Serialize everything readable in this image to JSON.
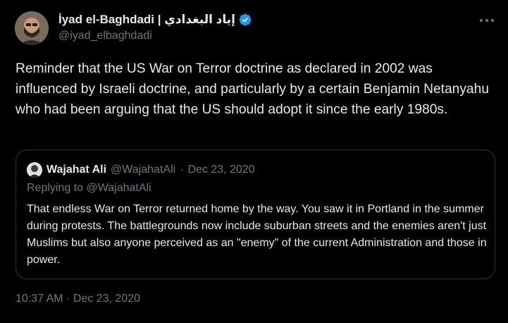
{
  "author": {
    "display_name": "İyad el-Baghdadi | إياد البغدادي",
    "handle": "@iyad_elbaghdadi",
    "verified_icon": "verified-badge-icon",
    "verified_color": "#1d9bf0"
  },
  "tweet": {
    "text": "Reminder that the US War on Terror doctrine as declared in 2002 was influenced by Israeli doctrine, and particularly by a certain Benjamin Netanyahu who had been arguing that the US should adopt it since the early 1980s.",
    "timestamp": "10:37 AM · Dec 23, 2020"
  },
  "quoted_tweet": {
    "display_name": "Wajahat Ali",
    "handle": "@WajahatAli",
    "separator": "·",
    "date": "Dec 23, 2020",
    "replying_prefix": "Replying to",
    "replying_to": "@WajahatAli",
    "text": "That endless War on Terror returned home by the way. You saw it in Portland in the summer during protests. The battlegrounds now include suburban streets and the enemies aren't just Muslims but also anyone perceived as an \"enemy\" of the current Administration and those in power."
  },
  "colors": {
    "background": "#000000",
    "primary_text": "#e7e9ea",
    "secondary_text": "#71767b",
    "border": "#2f3336"
  }
}
